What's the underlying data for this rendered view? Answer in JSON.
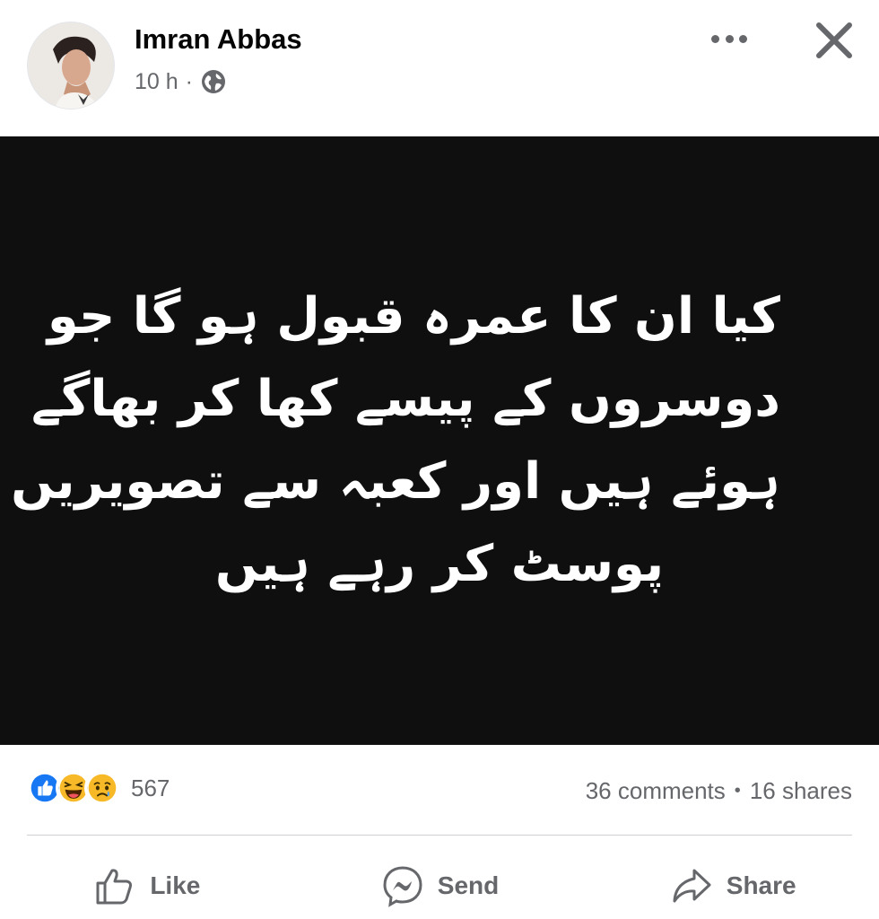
{
  "post": {
    "author": "Imran Abbas",
    "time": "10 h",
    "separator": "·",
    "privacy_icon": "globe-icon",
    "image_text_lines": [
      "کیا ان  کا عمرہ قبول ہو گا جو",
      "دوسروں کے پیسے کھا کر بھاگے",
      "ہوئے ہیں اور کعبہ سے تصویریں",
      "پوسٹ کر رہے  ہیں"
    ]
  },
  "stats": {
    "reaction_count": "567",
    "comments": "36 comments",
    "bullet": "•",
    "shares": "16 shares",
    "reactions": [
      "like",
      "haha",
      "sad"
    ]
  },
  "actions": {
    "like": "Like",
    "send": "Send",
    "share": "Share"
  },
  "colors": {
    "like_blue": "#1877f2",
    "emoji_yellow": "#f7b928",
    "meta_gray": "#65676b",
    "image_bg": "#0f0f0f"
  }
}
